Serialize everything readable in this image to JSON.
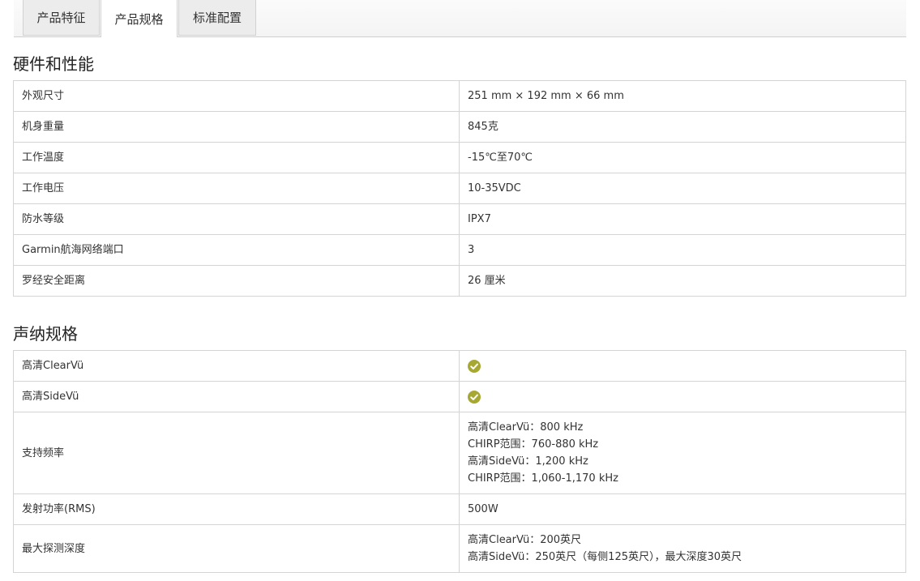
{
  "tabs": [
    "产品特征",
    "产品规格",
    "标准配置"
  ],
  "sections": [
    {
      "title": "硬件和性能",
      "rows": [
        {
          "label": "外观尺寸",
          "value": "251 mm × 192 mm × 66 mm"
        },
        {
          "label": "机身重量",
          "value": "845克"
        },
        {
          "label": "工作温度",
          "value": "-15℃至70℃"
        },
        {
          "label": "工作电压",
          "value": "10-35VDC"
        },
        {
          "label": "防水等级",
          "value": "IPX7"
        },
        {
          "label": "Garmin航海网络端口",
          "value": "3"
        },
        {
          "label": "罗经安全距离",
          "value": "26 厘米"
        }
      ]
    },
    {
      "title": "声纳规格",
      "rows": [
        {
          "label": "高清ClearVü",
          "check_icon": "check-circle-icon"
        },
        {
          "label": "高清SideVü",
          "check_icon": "check-circle-icon"
        },
        {
          "label": "支持频率",
          "lines": [
            "高清ClearVü：800 kHz",
            "CHIRP范围：760-880 kHz",
            "高清SideVü：1,200 kHz",
            "CHIRP范围：1,060-1,170 kHz"
          ]
        },
        {
          "label": "发射功率(RMS)",
          "value": "500W"
        },
        {
          "label": "最大探测深度",
          "lines": [
            "高清ClearVü：200英尺",
            "高清SideVü：250英尺（每侧125英尺），最大深度30英尺"
          ]
        }
      ]
    }
  ],
  "colors": {
    "check": "#a7a832",
    "border": "#d4d4d4"
  }
}
